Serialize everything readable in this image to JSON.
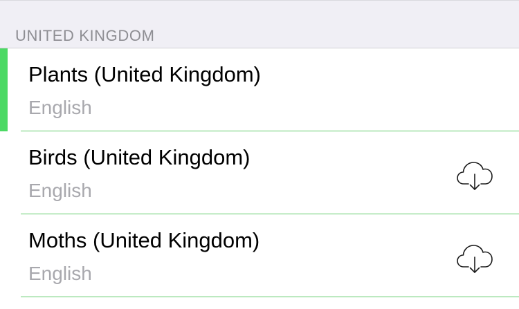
{
  "section": {
    "title": "UNITED KINGDOM"
  },
  "items": [
    {
      "title": "Plants (United Kingdom)",
      "subtitle": "English",
      "selected": true,
      "downloadable": false
    },
    {
      "title": "Birds (United Kingdom)",
      "subtitle": "English",
      "selected": false,
      "downloadable": true,
      "icon": "cloud-download-icon"
    },
    {
      "title": "Moths (United Kingdom)",
      "subtitle": "English",
      "selected": false,
      "downloadable": true,
      "icon": "cloud-download-icon"
    }
  ],
  "colors": {
    "accent": "#4cd964",
    "separator": "#5ecb68",
    "subtitle": "#a8a8ad",
    "header_bg": "#f0eff5",
    "header_text": "#8e8e93"
  }
}
